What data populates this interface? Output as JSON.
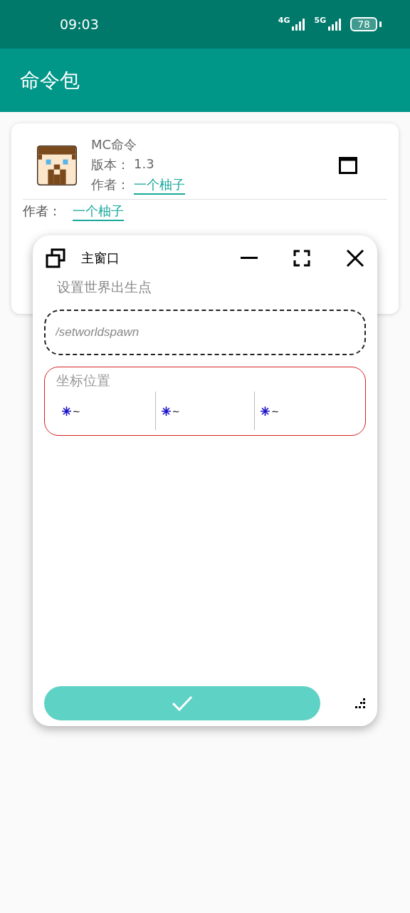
{
  "status_bar": {
    "time": "09:03",
    "signals": [
      "4G",
      "5G"
    ],
    "battery": "78"
  },
  "app_bar": {
    "title": "命令包"
  },
  "card": {
    "name": "MC命令",
    "version_label": "版本：",
    "version": "1.3",
    "author_label": "作者：",
    "author": "一个柚子",
    "detail_author_label": "作者：",
    "detail_author": "一个柚子"
  },
  "window": {
    "title": "主窗口",
    "description": "设置世界出生点",
    "command": {
      "placeholder": "/setworldspawn"
    },
    "coordinates": {
      "label": "坐标位置",
      "fields": [
        {
          "value": "~"
        },
        {
          "value": "~"
        },
        {
          "value": "~"
        }
      ]
    }
  }
}
